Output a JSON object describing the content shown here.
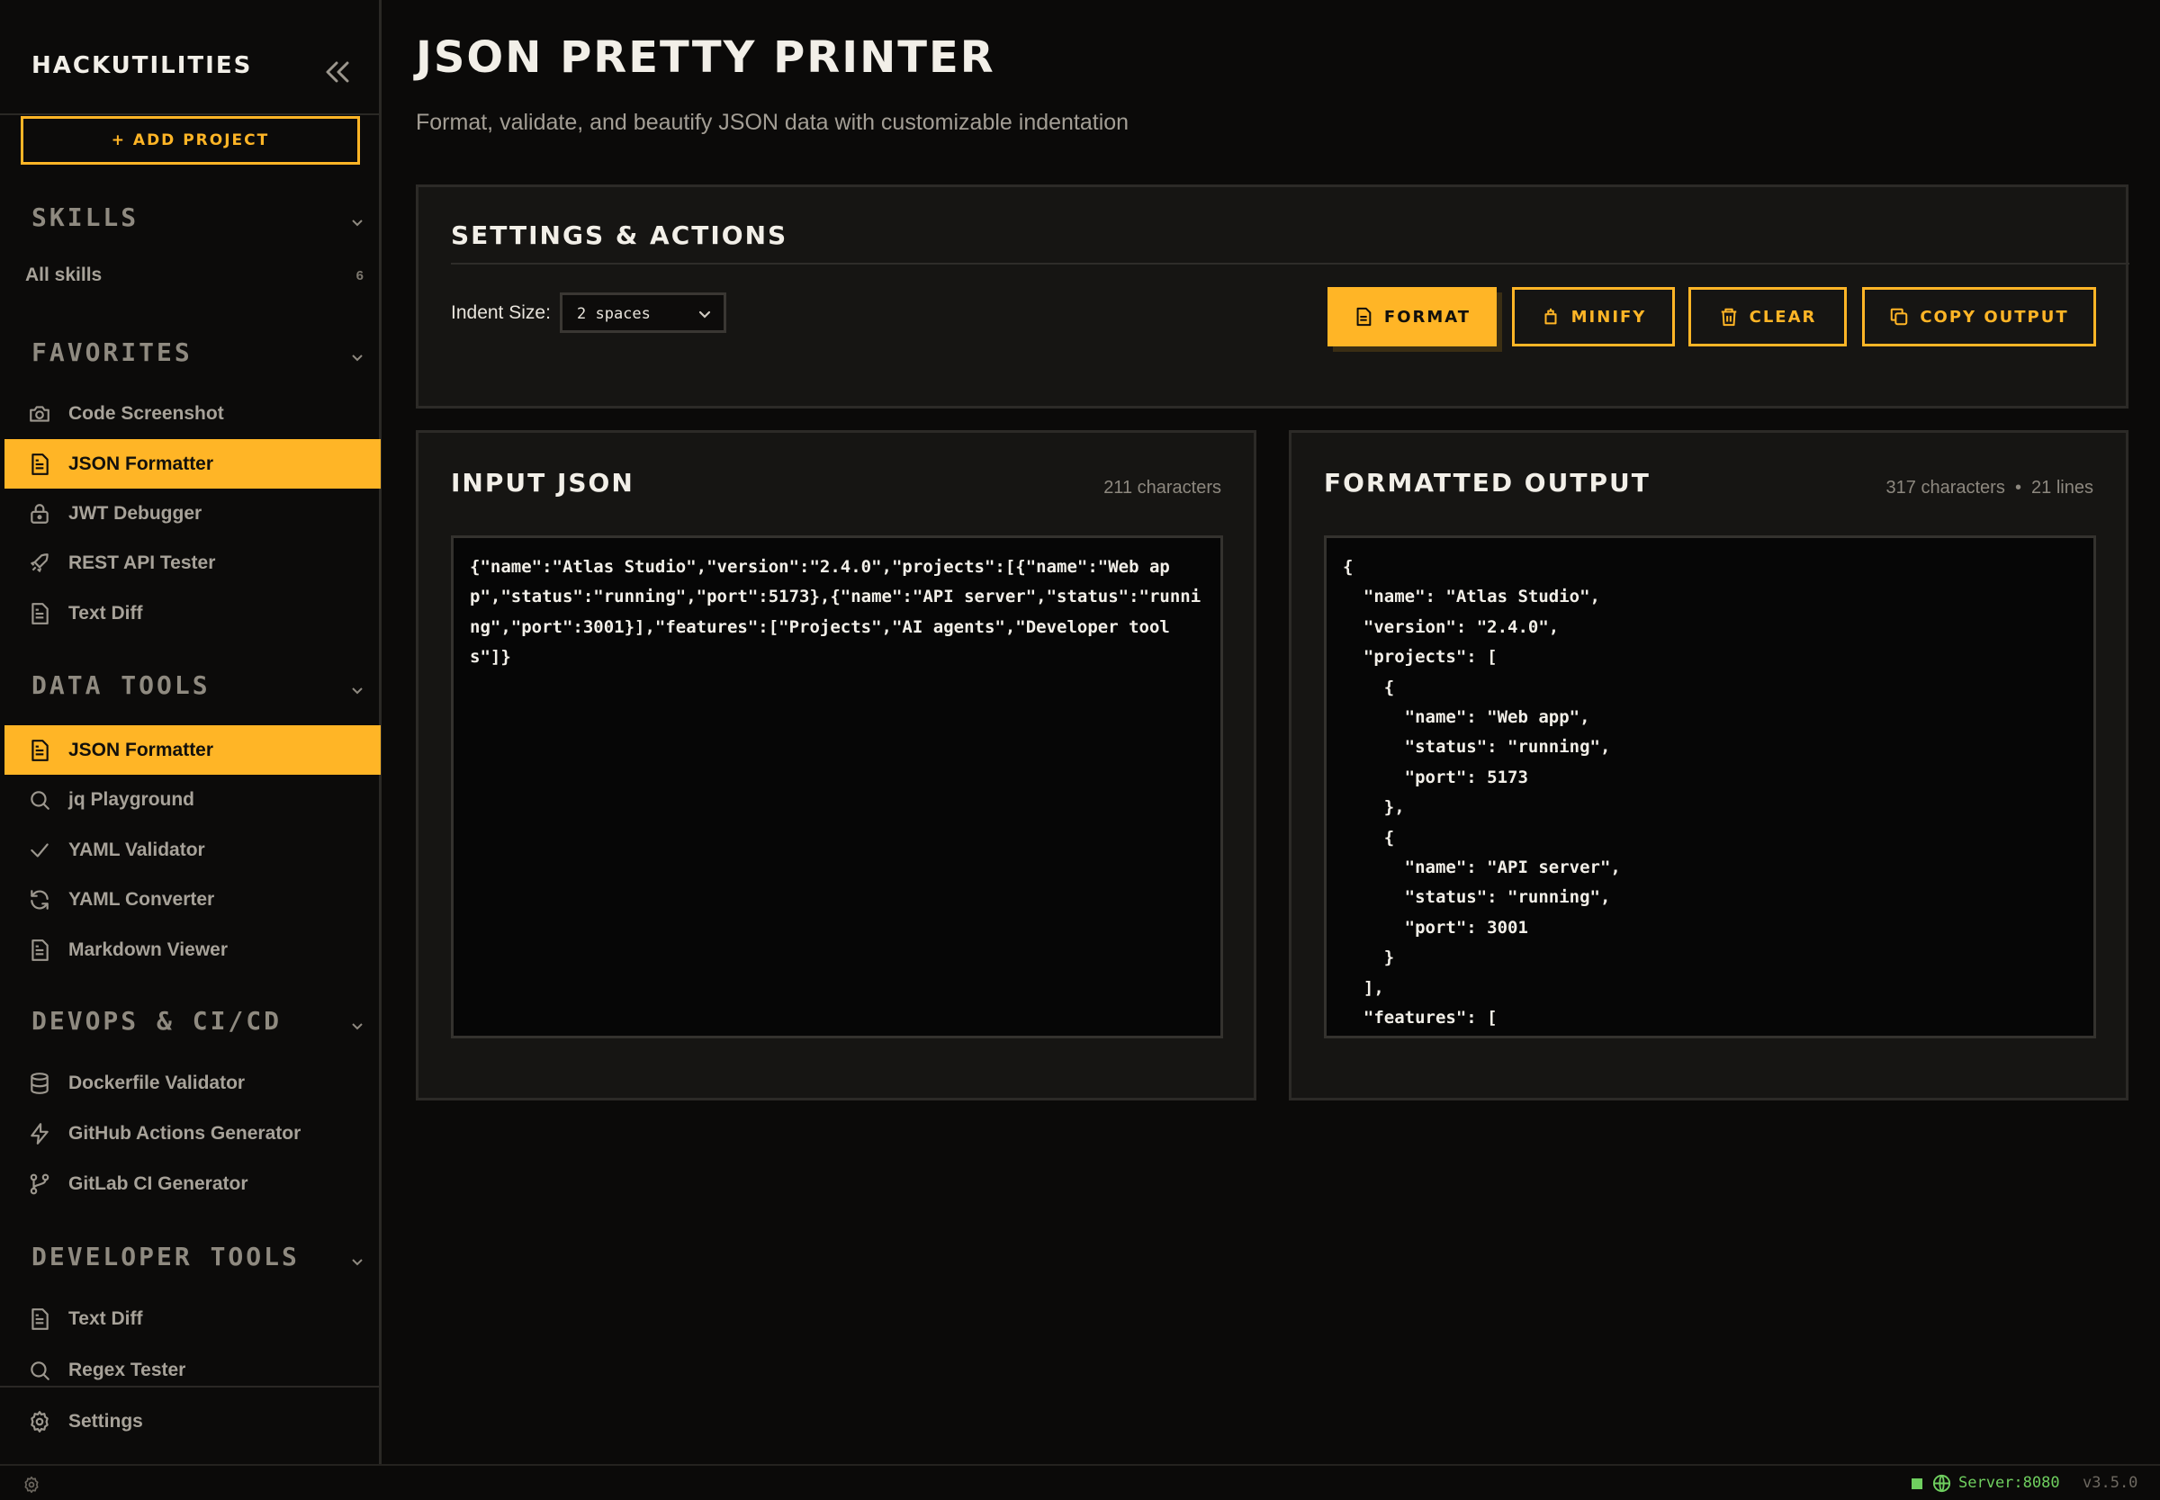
{
  "sidebar": {
    "brand": "HACKUTILITIES",
    "add_project_label": "+ ADD PROJECT",
    "skills": {
      "title": "SKILLS",
      "all_label": "All skills",
      "count": "6"
    },
    "favorites": {
      "title": "FAVORITES",
      "items": [
        {
          "label": "Code Screenshot",
          "icon": "camera-icon"
        },
        {
          "label": "JSON Formatter",
          "icon": "file-text-icon",
          "active": true
        },
        {
          "label": "JWT Debugger",
          "icon": "lock-icon"
        },
        {
          "label": "REST API Tester",
          "icon": "rocket-icon"
        },
        {
          "label": "Text Diff",
          "icon": "file-text-icon"
        }
      ]
    },
    "data_tools": {
      "title": "DATA TOOLS",
      "items": [
        {
          "label": "JSON Formatter",
          "icon": "file-text-icon",
          "active": true
        },
        {
          "label": "jq Playground",
          "icon": "search-icon"
        },
        {
          "label": "YAML Validator",
          "icon": "check-icon"
        },
        {
          "label": "YAML Converter",
          "icon": "refresh-icon"
        },
        {
          "label": "Markdown Viewer",
          "icon": "file-text-icon"
        }
      ]
    },
    "devops": {
      "title": "DEVOPS & CI/CD",
      "items": [
        {
          "label": "Dockerfile Validator",
          "icon": "database-icon"
        },
        {
          "label": "GitHub Actions Generator",
          "icon": "bolt-icon"
        },
        {
          "label": "GitLab CI Generator",
          "icon": "git-branch-icon"
        }
      ]
    },
    "developer_tools": {
      "title": "DEVELOPER TOOLS",
      "items": [
        {
          "label": "Text Diff",
          "icon": "file-text-icon"
        },
        {
          "label": "Regex Tester",
          "icon": "search-icon"
        }
      ]
    },
    "settings_label": "Settings"
  },
  "main": {
    "title": "JSON PRETTY PRINTER",
    "subtitle": "Format, validate, and beautify JSON data with customizable indentation",
    "settings": {
      "title": "SETTINGS & ACTIONS",
      "indent_label": "Indent Size:",
      "indent_value": "2 spaces",
      "buttons": {
        "format": "FORMAT",
        "minify": "MINIFY",
        "clear": "CLEAR",
        "copy": "COPY OUTPUT"
      }
    },
    "input": {
      "title": "INPUT JSON",
      "meta": "211 characters",
      "value": "{\"name\":\"Atlas Studio\",\"version\":\"2.4.0\",\"projects\":[{\"name\":\"Web app\",\"status\":\"running\",\"port\":5173},{\"name\":\"API server\",\"status\":\"running\",\"port\":3001}],\"features\":[\"Projects\",\"AI agents\",\"Developer tools\"]}"
    },
    "output": {
      "title": "FORMATTED OUTPUT",
      "meta": "317 characters  •  21 lines",
      "value": "{\n  \"name\": \"Atlas Studio\",\n  \"version\": \"2.4.0\",\n  \"projects\": [\n    {\n      \"name\": \"Web app\",\n      \"status\": \"running\",\n      \"port\": 5173\n    },\n    {\n      \"name\": \"API server\",\n      \"status\": \"running\",\n      \"port\": 3001\n    }\n  ],\n  \"features\": ["
    }
  },
  "statusbar": {
    "server": "Server:8080",
    "version": "v3.5.0"
  },
  "colors": {
    "accent": "#ffb526",
    "background": "#0b0a09",
    "panel": "#161513",
    "status_ok": "#6fcf5f"
  }
}
